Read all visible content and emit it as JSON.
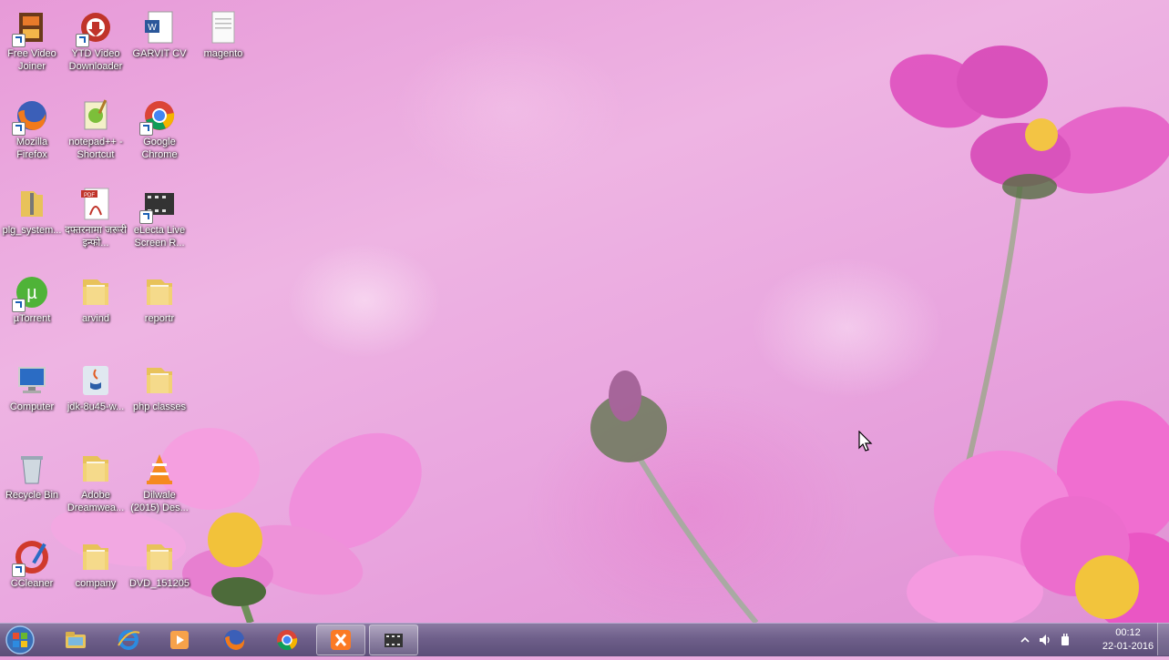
{
  "desktop": {
    "icons": [
      {
        "label": "Free Video Joiner",
        "icon": "video-joiner-icon"
      },
      {
        "label": "YTD Video Downloader",
        "icon": "ytd-downloader-icon"
      },
      {
        "label": "GARVIT CV",
        "icon": "word-document-icon"
      },
      {
        "label": "magento",
        "icon": "text-file-icon"
      },
      {
        "label": "Mozilla Firefox",
        "icon": "firefox-icon"
      },
      {
        "label": "notepad++ - Shortcut",
        "icon": "notepad-plus-icon"
      },
      {
        "label": "Google Chrome",
        "icon": "chrome-icon"
      },
      {
        "label": "plg_system...",
        "icon": "zip-folder-icon"
      },
      {
        "label": "दफ्तरनामा जरूरी इन्फो...",
        "icon": "pdf-icon"
      },
      {
        "label": "eLecta Live Screen R...",
        "icon": "film-icon"
      },
      {
        "label": "µTorrent",
        "icon": "utorrent-icon"
      },
      {
        "label": "arvind",
        "icon": "folder-icon"
      },
      {
        "label": "reportr",
        "icon": "folder-icon"
      },
      {
        "label": "Computer",
        "icon": "computer-icon"
      },
      {
        "label": "jdk-8u45-w...",
        "icon": "java-installer-icon"
      },
      {
        "label": "php classes",
        "icon": "folder-icon"
      },
      {
        "label": "Recycle Bin",
        "icon": "recycle-bin-icon"
      },
      {
        "label": "Adobe Dreamwea...",
        "icon": "folder-icon"
      },
      {
        "label": "Dilwale (2015) Des...",
        "icon": "vlc-icon"
      },
      {
        "label": "CCleaner",
        "icon": "ccleaner-icon"
      },
      {
        "label": "company",
        "icon": "folder-icon"
      },
      {
        "label": "DVD_151205",
        "icon": "folder-icon"
      }
    ]
  },
  "taskbar": {
    "start": "windows-start-icon",
    "pinned": [
      "file-explorer-icon",
      "internet-explorer-icon",
      "media-player-icon",
      "firefox-icon",
      "chrome-icon",
      "xampp-icon",
      "film-icon"
    ],
    "active_index": 5
  },
  "tray": {
    "time": "00:12",
    "date": "22-01-2016",
    "icons": [
      "show-hidden-icons-icon",
      "volume-icon",
      "power-icon"
    ]
  },
  "colors": {
    "taskbar": "#6e5f8a",
    "folder": "#f2cf6a",
    "wallpaper_pink": "#e9a6df"
  }
}
